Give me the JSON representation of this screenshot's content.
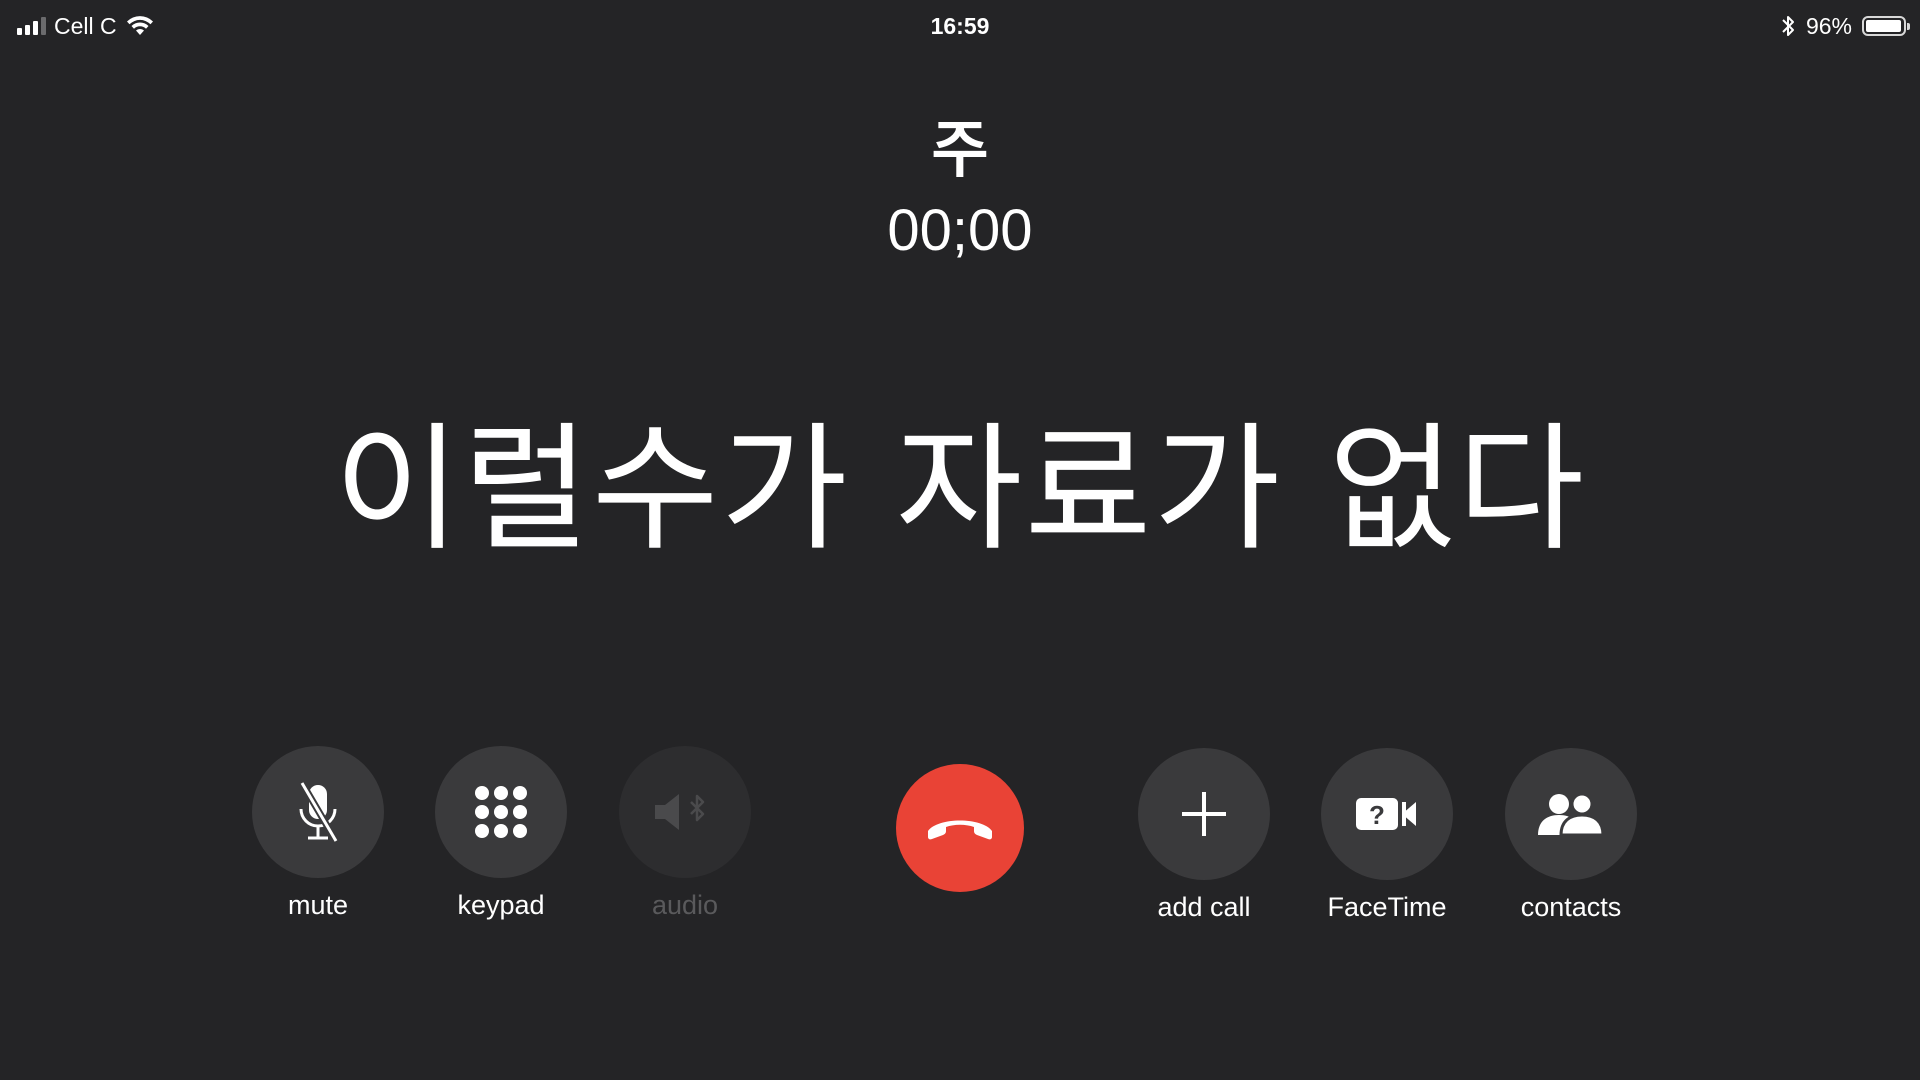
{
  "status_bar": {
    "carrier": "Cell C",
    "time": "16:59",
    "battery_percent_label": "96%",
    "battery_level": 0.96
  },
  "call": {
    "caller_name": "주",
    "timer": "00;00",
    "message": "이럴수가 자료가 없다"
  },
  "buttons": {
    "mute": {
      "label": "mute",
      "icon": "microphone-slash-icon",
      "enabled": true
    },
    "keypad": {
      "label": "keypad",
      "icon": "keypad-grid-icon",
      "enabled": true
    },
    "audio": {
      "label": "audio",
      "icon": "speaker-bluetooth-icon",
      "enabled": false
    },
    "end_call": {
      "icon": "phone-hangup-icon"
    },
    "add_call": {
      "label": "add call",
      "icon": "plus-icon",
      "enabled": true
    },
    "facetime": {
      "label": "FaceTime",
      "icon": "facetime-question-icon",
      "enabled": true
    },
    "contacts": {
      "label": "contacts",
      "icon": "contacts-people-icon",
      "enabled": true
    }
  },
  "colors": {
    "background": "#242426",
    "button_background": "#3a3a3c",
    "button_disabled": "#2d2d2f",
    "end_call_red": "#e94336",
    "disabled_text": "#5a5a5c"
  }
}
